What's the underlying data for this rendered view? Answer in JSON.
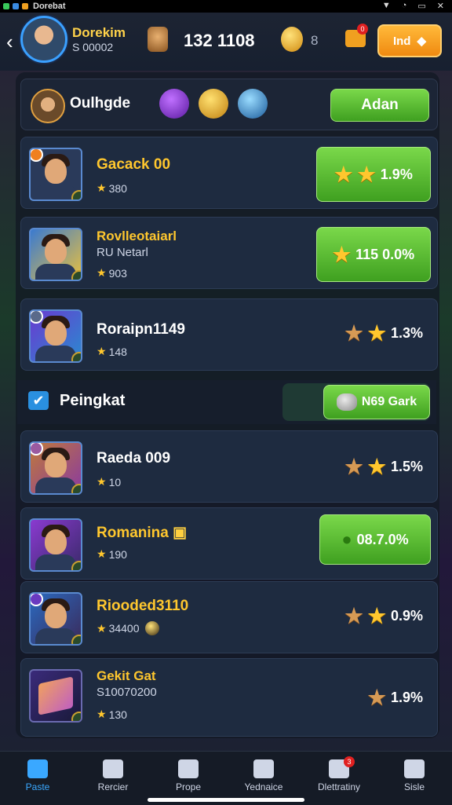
{
  "status_bar": {
    "title": "Dorebat"
  },
  "header": {
    "username": "Dorekim",
    "user_id": "S 00002",
    "points": "132 1108",
    "coins": "8",
    "mail_badge": "0",
    "action_label": "Ind"
  },
  "header_section": {
    "title": "Oulhgde",
    "button_label": "Adan"
  },
  "rows_top": [
    {
      "name": "Gacack 00",
      "subtitle": "",
      "score": "380",
      "reward_value": "1.9%"
    },
    {
      "name": "Rovlleotaiarl",
      "subtitle": "RU Netarl",
      "score": "903",
      "reward_value": "115  0.0%"
    },
    {
      "name": "Roraipn1149",
      "subtitle": "",
      "score": "148",
      "reward_value": "1.3%"
    }
  ],
  "section2": {
    "title": "Peingkat",
    "button_label": "N69 Gark"
  },
  "rows_bottom": [
    {
      "name": "Raeda 009",
      "subtitle": "",
      "score": "10",
      "reward_value": "1.5%"
    },
    {
      "name": "Romanina",
      "subtitle": "",
      "score": "190",
      "reward_value": "08.7.0%"
    },
    {
      "name": "Riooded3110",
      "subtitle": "",
      "score": "34400",
      "reward_value": "0.9%"
    },
    {
      "name": "Gekit Gat",
      "subtitle": "S10070200",
      "score": "130",
      "reward_value": "1.9%"
    }
  ],
  "nav": [
    {
      "label": "Paste",
      "icon": "home-icon",
      "active": true
    },
    {
      "label": "Rercier",
      "icon": "house-icon",
      "active": false
    },
    {
      "label": "Prope",
      "icon": "chart-icon",
      "active": false
    },
    {
      "label": "Yednaice",
      "icon": "shop-icon",
      "active": false
    },
    {
      "label": "Dlettratiny",
      "icon": "chat-icon",
      "active": false,
      "badge": "3"
    },
    {
      "label": "Sisle",
      "icon": "profile-icon",
      "active": false
    }
  ],
  "colors": {
    "accent_green": "#4fb82a",
    "accent_gold": "#ffc72e",
    "accent_blue": "#3aa8ff",
    "panel": "#1e2b40"
  }
}
